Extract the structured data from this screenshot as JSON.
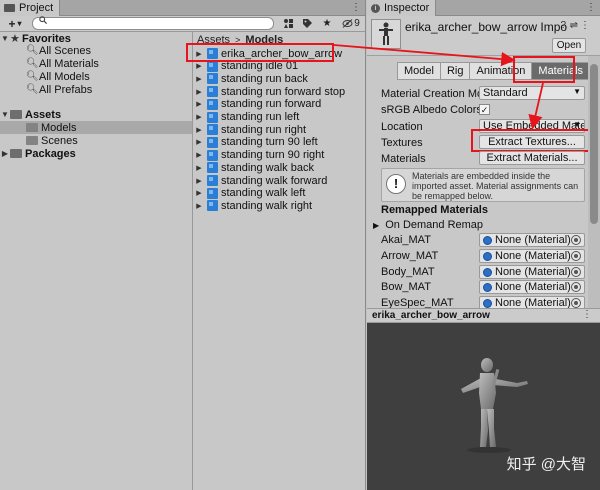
{
  "project": {
    "tab_title": "Project",
    "tab_menu": "⋮",
    "toolbar": {
      "add_label": "+",
      "add_arrow": "▾",
      "search_icon": "🔍",
      "search_value": "",
      "hidden_count": "9"
    },
    "tree": {
      "favorites_label": "Favorites",
      "favorites": [
        "All Scenes",
        "All Materials",
        "All Models",
        "All Prefabs"
      ],
      "assets_label": "Assets",
      "asset_folders": [
        "Models",
        "Scenes"
      ],
      "packages_label": "Packages"
    },
    "breadcrumb": {
      "root": "Assets",
      "sep": ">",
      "current": "Models"
    },
    "assets": [
      "erika_archer_bow_arrow",
      "standing idle 01",
      "standing run back",
      "standing run forward stop",
      "standing run forward",
      "standing run left",
      "standing run right",
      "standing turn 90 left",
      "standing turn 90 right",
      "standing walk back",
      "standing walk forward",
      "standing walk left",
      "standing walk right"
    ]
  },
  "inspector": {
    "tab_title": "Inspector",
    "title": "erika_archer_bow_arrow Impo",
    "open_label": "Open",
    "tabs": [
      "Model",
      "Rig",
      "Animation",
      "Materials"
    ],
    "active_tab": "Materials",
    "props": {
      "creation_mode_label": "Material Creation Mo",
      "creation_mode_value": "Standard",
      "srgb_label": "sRGB Albedo Colors",
      "srgb_checked": "✓",
      "location_label": "Location",
      "location_value": "Use Embedded Mate",
      "textures_label": "Textures",
      "extract_textures_label": "Extract Textures...",
      "materials_label": "Materials",
      "extract_materials_label": "Extract Materials..."
    },
    "help_text": "Materials are embedded inside the imported asset. Material assignments can be remapped below.",
    "remapped_header": "Remapped Materials",
    "on_demand_label": "On Demand Remap",
    "materials": [
      {
        "name": "Akai_MAT",
        "value": "None (Material)"
      },
      {
        "name": "Arrow_MAT",
        "value": "None (Material)"
      },
      {
        "name": "Body_MAT",
        "value": "None (Material)"
      },
      {
        "name": "Bow_MAT",
        "value": "None (Material)"
      },
      {
        "name": "EyeSpec_MAT",
        "value": "None (Material)"
      }
    ],
    "preview_title": "erika_archer_bow_arrow",
    "watermark": "知乎 @大智"
  },
  "colors": {
    "highlight_red": "#e8141b",
    "model_icon_blue": "#2a7ed6",
    "active_tab_bg": "#6b6b6b"
  }
}
